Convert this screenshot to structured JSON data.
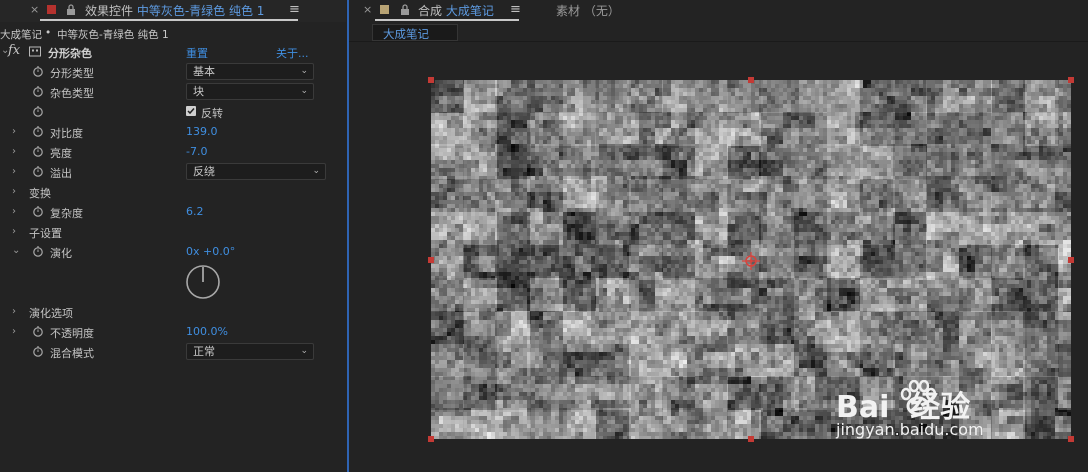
{
  "left_panel": {
    "tab": {
      "close": "×",
      "title_prefix": "效果控件",
      "title_highlight": "中等灰色-青绿色 纯色 1",
      "menu": "≡"
    },
    "breadcrumb": {
      "comp": "大成笔记",
      "sep": "•",
      "layer": "中等灰色-青绿色 纯色 1"
    },
    "effect": {
      "fx_icon": "fx",
      "name": "分形杂色",
      "reset": "重置",
      "about": "关于..."
    },
    "properties": {
      "fractal_type": {
        "label": "分形类型",
        "value": "基本"
      },
      "noise_type": {
        "label": "杂色类型",
        "value": "块"
      },
      "invert": {
        "label": "反转",
        "checked": true
      },
      "contrast": {
        "label": "对比度",
        "value": "139.0"
      },
      "brightness": {
        "label": "亮度",
        "value": "-7.0"
      },
      "overflow": {
        "label": "溢出",
        "value": "反绕"
      },
      "transform": {
        "label": "变换"
      },
      "complexity": {
        "label": "复杂度",
        "value": "6.2"
      },
      "sub_settings": {
        "label": "子设置"
      },
      "evolution": {
        "label": "演化",
        "value": "0x +0.0°"
      },
      "evolution_options": {
        "label": "演化选项"
      },
      "opacity": {
        "label": "不透明度",
        "value": "100.0%"
      },
      "blend_mode": {
        "label": "混合模式",
        "value": "正常"
      }
    }
  },
  "right_panel": {
    "tab": {
      "close": "×",
      "title_prefix": "合成",
      "title_highlight": "大成笔记",
      "menu": "≡"
    },
    "footage_tab": "素材 （无）",
    "comp_subtab": "大成笔记"
  },
  "watermark": {
    "brand": "Bai  经验",
    "url": "jingyan.baidu.com"
  },
  "colors": {
    "accent_blue": "#3f8ee0",
    "handle_red": "#c43a35",
    "panel_bg": "#232323"
  }
}
